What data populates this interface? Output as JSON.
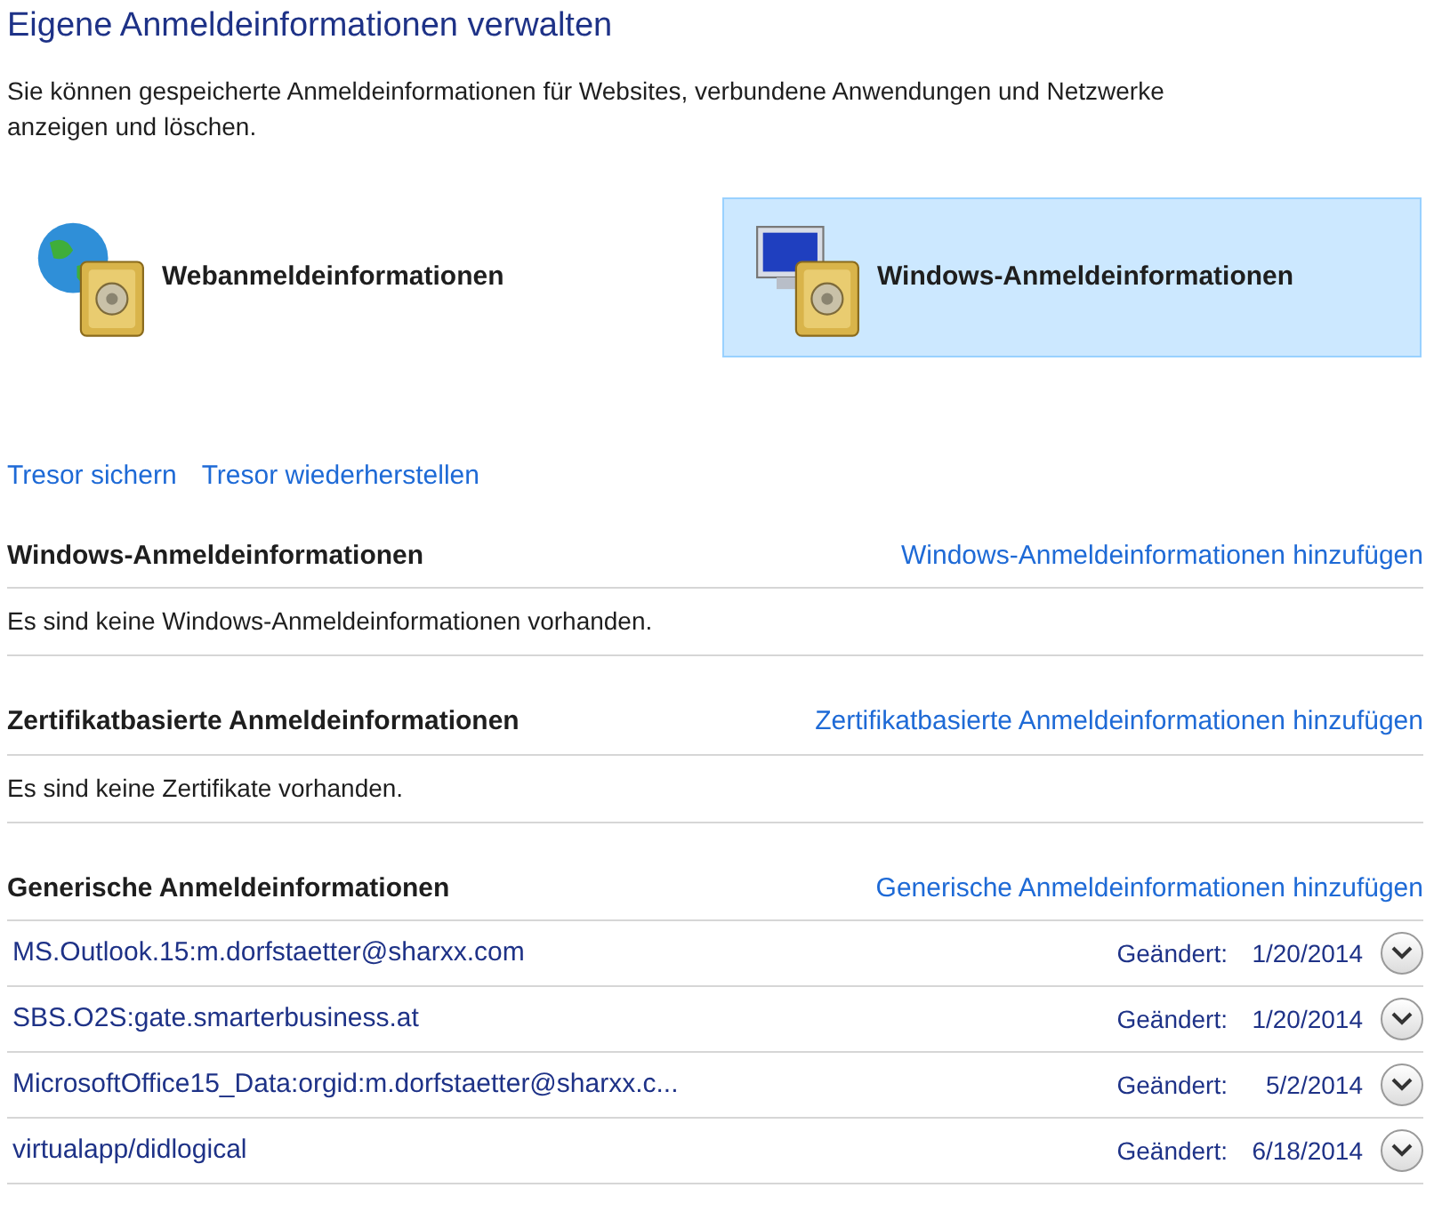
{
  "title": "Eigene Anmeldeinformationen verwalten",
  "description": "Sie können gespeicherte Anmeldeinformationen für Websites, verbundene Anwendungen und Netzwerke anzeigen und löschen.",
  "tiles": [
    {
      "kind": "web",
      "label": "Webanmeldeinformationen",
      "selected": false
    },
    {
      "kind": "windows",
      "label": "Windows-Anmeldeinformationen",
      "selected": true
    }
  ],
  "vault_links": [
    "Tresor sichern",
    "Tresor wiederherstellen"
  ],
  "sections": [
    {
      "heading": "Windows-Anmeldeinformationen",
      "add_link": "Windows-Anmeldeinformationen hinzufügen",
      "empty_text": "Es sind keine Windows-Anmeldeinformationen vorhanden."
    },
    {
      "heading": "Zertifikatbasierte Anmeldeinformationen",
      "add_link": "Zertifikatbasierte Anmeldeinformationen hinzufügen",
      "empty_text": "Es sind keine Zertifikate vorhanden."
    },
    {
      "heading": "Generische Anmeldeinformationen",
      "add_link": "Generische Anmeldeinformationen hinzufügen",
      "items": [
        {
          "name": "MS.Outlook.15:m.dorfstaetter@sharxx.com",
          "modified_label": "Geändert:",
          "date": "1/20/2014",
          "expanded": false
        },
        {
          "name": "SBS.O2S:gate.smarterbusiness.at",
          "modified_label": "Geändert:",
          "date": "1/20/2014",
          "expanded": false
        },
        {
          "name": "MicrosoftOffice15_Data:orgid:m.dorfstaetter@sharxx.c...",
          "modified_label": "Geändert:",
          "date": "5/2/2014",
          "expanded": false
        },
        {
          "name": "virtualapp/didlogical",
          "modified_label": "Geändert:",
          "date": "6/18/2014",
          "expanded": false
        }
      ]
    }
  ]
}
